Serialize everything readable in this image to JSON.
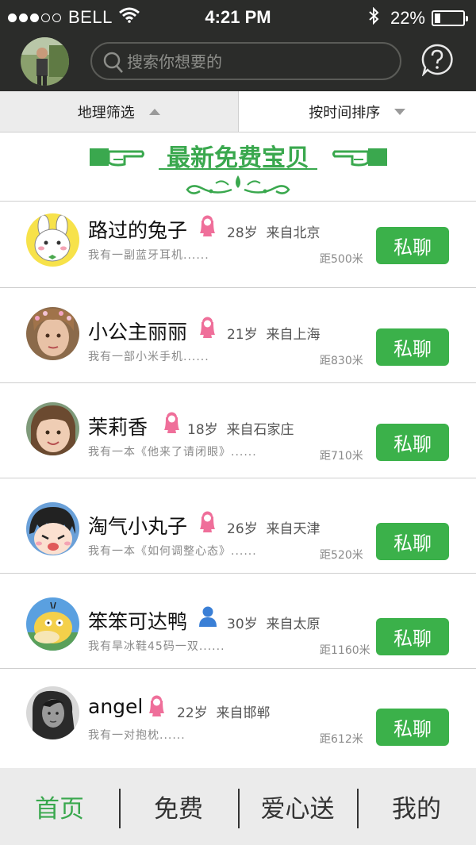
{
  "status_bar": {
    "carrier": "BELL",
    "time": "4:21 PM",
    "battery_text": "22%",
    "battery_level": 0.22,
    "signal_bars": 3
  },
  "header": {
    "search_placeholder": "搜索你想要的",
    "icons": [
      "search-icon",
      "help-chat-icon",
      "avatar"
    ]
  },
  "filters": {
    "location_label": "地理筛选",
    "sort_label": "按时间排序"
  },
  "banner": {
    "title": "最新免费宝贝"
  },
  "users": [
    {
      "name": "路过的兔子",
      "gender": "female",
      "age": "28岁",
      "from": "来自北京",
      "desc": "我有一副蓝牙耳机......",
      "distance": "距500米",
      "chat_label": "私聊"
    },
    {
      "name": "小公主丽丽",
      "gender": "female",
      "age": "21岁",
      "from": "来自上海",
      "desc": "我有一部小米手机......",
      "distance": "距830米",
      "chat_label": "私聊"
    },
    {
      "name": "茉莉香",
      "gender": "female",
      "age": "18岁",
      "from": "来自石家庄",
      "desc": "我有一本《他来了请闭眼》......",
      "distance": "距710米",
      "chat_label": "私聊"
    },
    {
      "name": "淘气小丸子",
      "gender": "female",
      "age": "26岁",
      "from": "来自天津",
      "desc": "我有一本《如何调整心态》......",
      "distance": "距520米",
      "chat_label": "私聊"
    },
    {
      "name": "笨笨可达鸭",
      "gender": "male",
      "age": "30岁",
      "from": "来自太原",
      "desc": "我有旱冰鞋45码一双......",
      "distance": "距1160米",
      "chat_label": "私聊"
    },
    {
      "name": "angel",
      "gender": "female",
      "age": "22岁",
      "from": "来自邯郸",
      "desc": "我有一对抱枕......",
      "distance": "距612米",
      "chat_label": "私聊"
    }
  ],
  "tabbar": {
    "tabs": [
      {
        "label": "首页",
        "active": true
      },
      {
        "label": "免费",
        "active": false
      },
      {
        "label": "爱心送",
        "active": false
      },
      {
        "label": "我的",
        "active": false
      }
    ]
  },
  "colors": {
    "accent_green": "#3bb14a",
    "header_bg": "#2b2c2a",
    "female_pink": "#ef6f9a",
    "male_blue": "#3a7fd6"
  }
}
